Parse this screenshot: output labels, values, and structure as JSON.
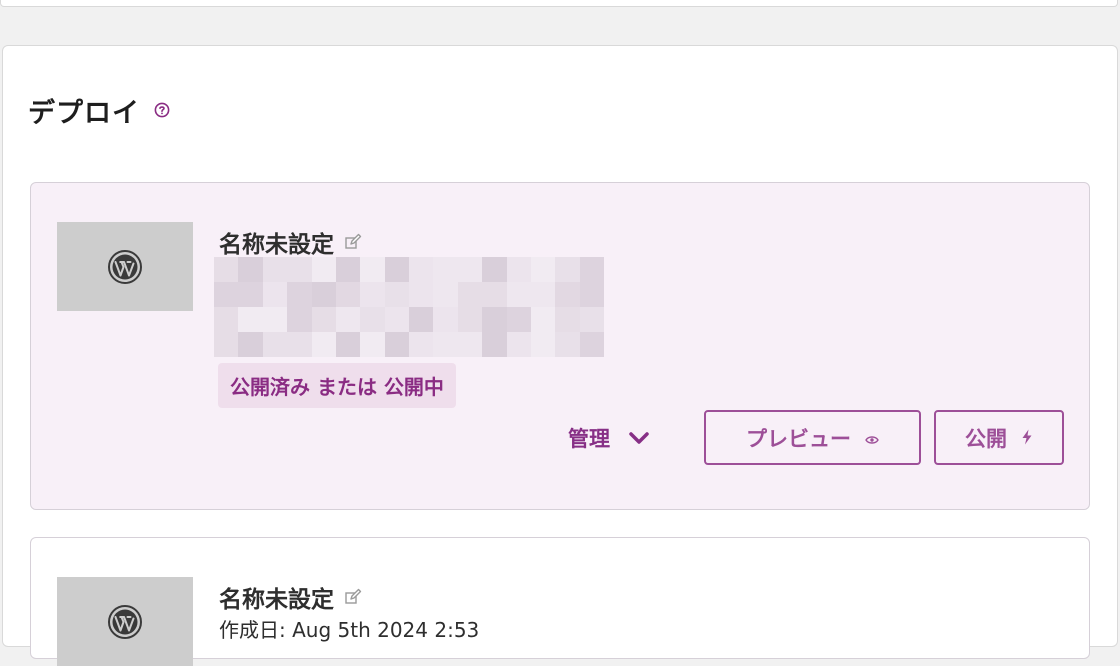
{
  "deploy": {
    "title": "デプロイ",
    "help_icon": "question-circle-icon"
  },
  "sites": [
    {
      "name": "名称未設定",
      "status": "公開済み または 公開中",
      "actions": {
        "manage_label": "管理",
        "preview_label": "プレビュー",
        "publish_label": "公開"
      }
    },
    {
      "name": "名称未設定",
      "meta": "作成日: Aug 5th 2024 2:53"
    }
  ],
  "colors": {
    "accent": "#8a2c83",
    "card_active_bg": "#f8f0f8",
    "badge_bg": "#efdeec",
    "thumb_bg": "#cdcdcd"
  }
}
